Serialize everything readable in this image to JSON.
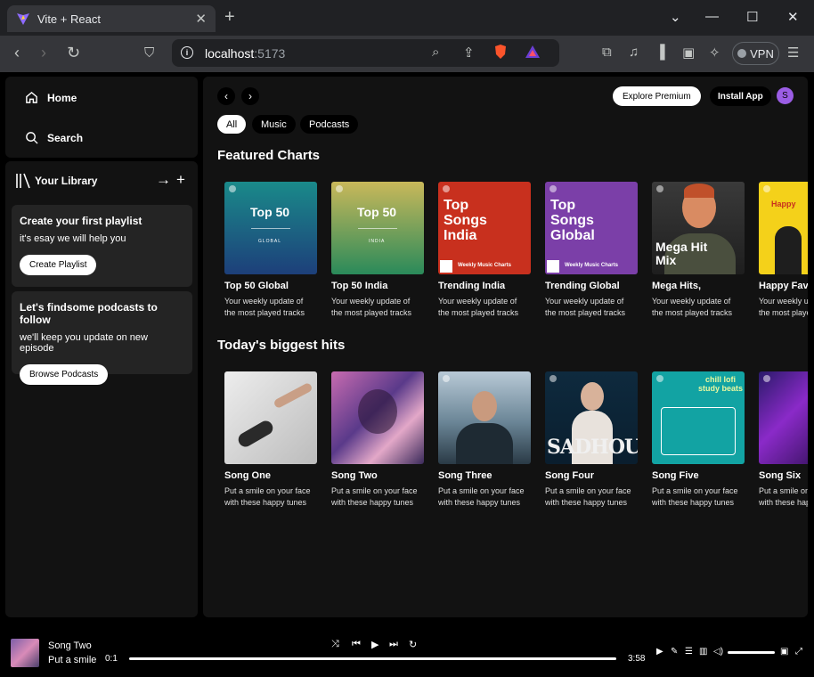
{
  "browser": {
    "tab_title": "Vite + React",
    "tab_close": "✕",
    "new_tab": "+",
    "url_host": "localhost",
    "url_port": ":5173",
    "vpn_label": "VPN"
  },
  "sidebar": {
    "home_label": "Home",
    "search_label": "Search",
    "library_label": "Your Library",
    "playlist_card": {
      "title": "Create your first playlist",
      "subtitle": "it's esay we will help you",
      "button": "Create Playlist"
    },
    "podcast_card": {
      "title": "Let's findsome podcasts to follow",
      "subtitle": "we'll keep you update on new episode",
      "button": "Browse Podcasts"
    }
  },
  "topbar": {
    "premium_label": "Explore Premium",
    "install_label": "Install App",
    "avatar_letter": "S"
  },
  "chips": [
    "All",
    "Music",
    "Podcasts"
  ],
  "sections": {
    "featured_title": "Featured Charts",
    "hits_title": "Today's biggest hits"
  },
  "featured": [
    {
      "name": "Top 50 Global",
      "desc1": "Your weekly update of",
      "desc2": "the most played tracks",
      "cover_text": "Top 50",
      "cover_sub": "GLOBAL",
      "color": "#1e6b8a"
    },
    {
      "name": "Top 50 India",
      "desc1": "Your weekly update of",
      "desc2": "the most played tracks",
      "cover_text": "Top 50",
      "cover_sub": "INDIA",
      "color": "#4f9a58"
    },
    {
      "name": "Trending India",
      "desc1": "Your weekly update of",
      "desc2": "the most played tracks",
      "cover_text": "Top Songs India",
      "cover_sub": "Weekly Music Charts",
      "color": "#c8301e"
    },
    {
      "name": "Trending Global",
      "desc1": "Your weekly update of",
      "desc2": "the most played tracks",
      "cover_text": "Top Songs Global",
      "cover_sub": "Weekly Music Charts",
      "color": "#7b3fa8"
    },
    {
      "name": "Mega Hits,",
      "desc1": "Your weekly update of",
      "desc2": "the most played tracks",
      "cover_text": "Mega Hit Mix",
      "cover_sub": "",
      "color": "#2c2c2c"
    },
    {
      "name": "Happy Favorites",
      "desc1": "Your weekly update of",
      "desc2": "the most played tracks",
      "cover_text": "Happy",
      "cover_sub": "",
      "color": "#f4d11a"
    }
  ],
  "hits": [
    {
      "name": "Song One",
      "desc1": "Put a smile on your face",
      "desc2": "with these happy tunes"
    },
    {
      "name": "Song Two",
      "desc1": "Put a smile on your face",
      "desc2": "with these happy tunes"
    },
    {
      "name": "Song Three",
      "desc1": "Put a smile on your face",
      "desc2": "with these happy tunes"
    },
    {
      "name": "Song Four",
      "desc1": "Put a smile on your face",
      "desc2": "with these happy tunes",
      "cover_text": "SADHOUR"
    },
    {
      "name": "Song Five",
      "desc1": "Put a smile on your face",
      "desc2": "with these happy tunes",
      "cover_text": "chill lofi study beats"
    },
    {
      "name": "Song Six",
      "desc1": "Put a smile on your face",
      "desc2": "with these happy tunes"
    }
  ],
  "player": {
    "title": "Song Two",
    "artist": "Put a smile",
    "current_time": "0:1",
    "duration": "3:58",
    "progress_fraction": 0.01
  }
}
